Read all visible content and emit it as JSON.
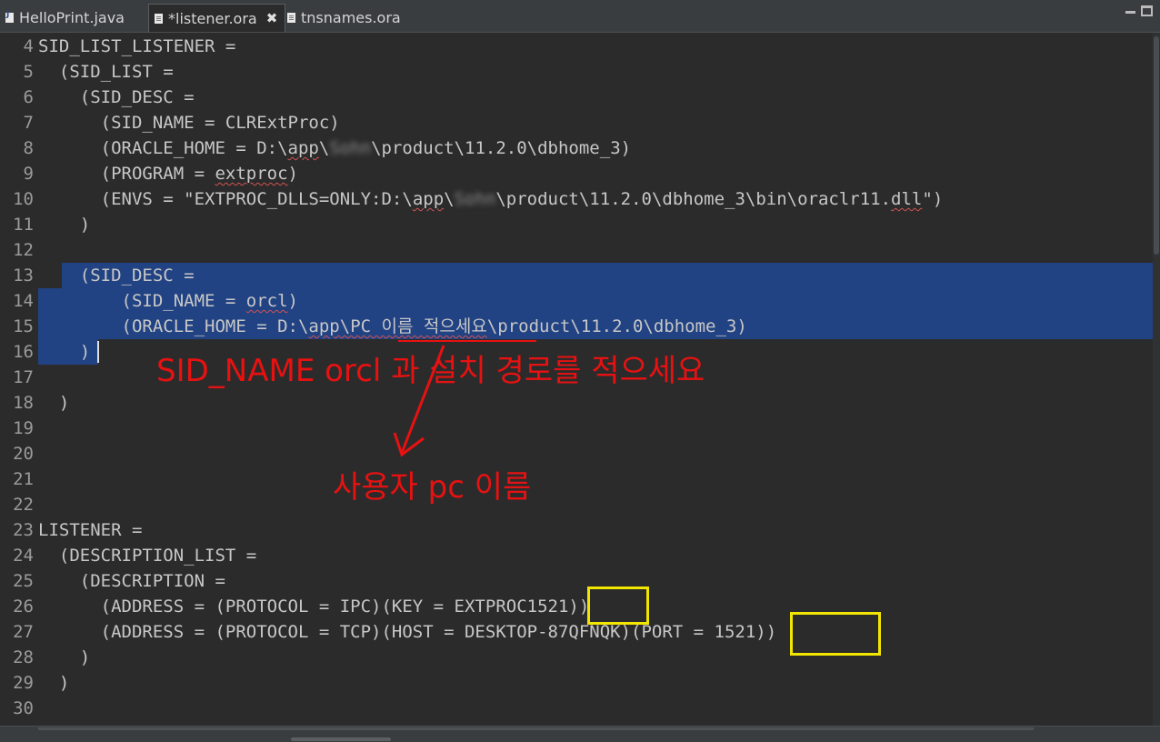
{
  "tabs": [
    {
      "label": "HelloPrint.java",
      "icon": "java-file-icon",
      "active": false
    },
    {
      "label": "*listener.ora",
      "icon": "text-file-icon",
      "active": true,
      "close": "✖"
    },
    {
      "label": "tnsnames.ora",
      "icon": "text-file-icon",
      "active": false
    }
  ],
  "editor": {
    "lines": [
      {
        "n": "4",
        "segments": [
          {
            "t": "SID_LIST_LISTENER ="
          }
        ]
      },
      {
        "n": "5",
        "segments": [
          {
            "t": "  (SID_LIST ="
          }
        ]
      },
      {
        "n": "6",
        "segments": [
          {
            "t": "    (SID_DESC ="
          }
        ]
      },
      {
        "n": "7",
        "segments": [
          {
            "t": "      (SID_NAME = CLRExtProc)"
          }
        ]
      },
      {
        "n": "8",
        "segments": [
          {
            "t": "      (ORACLE_HOME = D:\\"
          },
          {
            "t": "app",
            "sq": true
          },
          {
            "t": "\\"
          },
          {
            "t": "Sohn",
            "blur": true
          },
          {
            "t": "\\product\\11.2.0\\dbhome_3)"
          }
        ]
      },
      {
        "n": "9",
        "segments": [
          {
            "t": "      (PROGRAM = "
          },
          {
            "t": "extproc",
            "sq": true
          },
          {
            "t": ")"
          }
        ]
      },
      {
        "n": "10",
        "segments": [
          {
            "t": "      (ENVS = \"EXTPROC_DLLS=ONLY:D:\\"
          },
          {
            "t": "app",
            "sq": true
          },
          {
            "t": "\\"
          },
          {
            "t": "Sohn",
            "blur": true
          },
          {
            "t": "\\product\\11.2.0\\dbhome_3\\bin\\oraclr11."
          },
          {
            "t": "dll",
            "sq": true
          },
          {
            "t": "\")"
          }
        ]
      },
      {
        "n": "11",
        "segments": [
          {
            "t": "    )"
          }
        ]
      },
      {
        "n": "12",
        "segments": [
          {
            "t": ""
          }
        ]
      },
      {
        "n": "13",
        "segments": [
          {
            "t": "    (SID_DESC ="
          }
        ]
      },
      {
        "n": "14",
        "segments": [
          {
            "t": "        (SID_NAME = "
          },
          {
            "t": "orcl",
            "sq": true
          },
          {
            "t": ")"
          }
        ]
      },
      {
        "n": "15",
        "segments": [
          {
            "t": "        (ORACLE_HOME = D:\\"
          },
          {
            "t": "app",
            "sq": true
          },
          {
            "t": "\\PC 이름 적으세요",
            "sq": true
          },
          {
            "t": "\\product\\11.2.0\\dbhome_3)"
          }
        ]
      },
      {
        "n": "16",
        "segments": [
          {
            "t": "    )"
          }
        ]
      },
      {
        "n": "17",
        "segments": [
          {
            "t": ""
          }
        ]
      },
      {
        "n": "18",
        "segments": [
          {
            "t": "  )"
          }
        ]
      },
      {
        "n": "19",
        "segments": [
          {
            "t": ""
          }
        ]
      },
      {
        "n": "20",
        "segments": [
          {
            "t": ""
          }
        ]
      },
      {
        "n": "21",
        "segments": [
          {
            "t": ""
          }
        ]
      },
      {
        "n": "22",
        "segments": [
          {
            "t": ""
          }
        ]
      },
      {
        "n": "23",
        "segments": [
          {
            "t": "LISTENER ="
          }
        ]
      },
      {
        "n": "24",
        "segments": [
          {
            "t": "  (DESCRIPTION_LIST ="
          }
        ]
      },
      {
        "n": "25",
        "segments": [
          {
            "t": "    (DESCRIPTION ="
          }
        ]
      },
      {
        "n": "26",
        "segments": [
          {
            "t": "      (ADDRESS = (PROTOCOL = IPC)(KEY = EXTPROC1521))"
          }
        ]
      },
      {
        "n": "27",
        "segments": [
          {
            "t": "      (ADDRESS = (PROTOCOL = TCP)(HOST = DESKTOP-87QFNQK)(PORT = 1521))"
          }
        ]
      },
      {
        "n": "28",
        "segments": [
          {
            "t": "    )"
          }
        ]
      },
      {
        "n": "29",
        "segments": [
          {
            "t": "  )"
          }
        ]
      },
      {
        "n": "30",
        "segments": [
          {
            "t": ""
          }
        ]
      }
    ]
  },
  "annotations": {
    "instruction": "SID_NAME orcl 과 설치 경로를 적으세요",
    "pc_name_note": "사용자 pc 이름",
    "highlight_color": "#f2e600",
    "annotation_color": "#e81111",
    "selection_color": "#214283"
  }
}
